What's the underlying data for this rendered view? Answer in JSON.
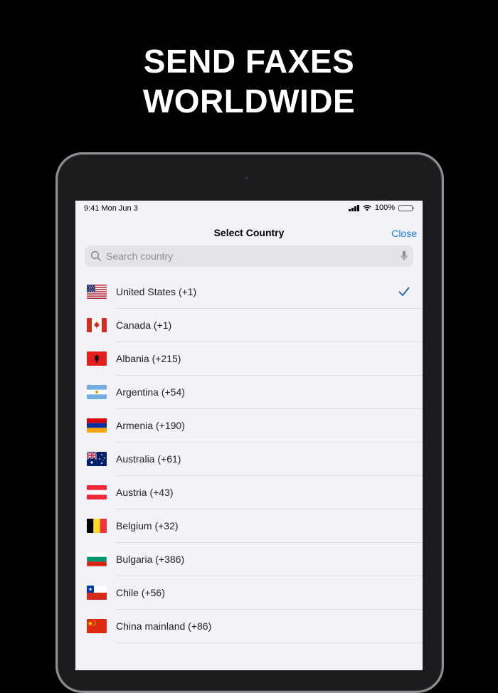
{
  "headline": {
    "line1": "SEND FAXES",
    "line2": "WORLDWIDE"
  },
  "status_bar": {
    "time": "9:41  Mon Jun 3",
    "battery": "100%"
  },
  "nav": {
    "title": "Select Country",
    "close_label": "Close"
  },
  "search": {
    "placeholder": "Search country",
    "value": ""
  },
  "colors": {
    "accent": "#1a7cf5",
    "background": "#000000",
    "sheet": "#f2f2f7"
  },
  "countries": [
    {
      "label": "United States (+1)",
      "flag": "flag-us",
      "selected": true
    },
    {
      "label": "Canada (+1)",
      "flag": "flag-ca",
      "selected": false
    },
    {
      "label": "Albania (+215)",
      "flag": "flag-al",
      "selected": false
    },
    {
      "label": "Argentina (+54)",
      "flag": "flag-ar",
      "selected": false
    },
    {
      "label": "Armenia (+190)",
      "flag": "flag-am",
      "selected": false
    },
    {
      "label": "Australia (+61)",
      "flag": "flag-au",
      "selected": false
    },
    {
      "label": "Austria (+43)",
      "flag": "flag-at",
      "selected": false
    },
    {
      "label": "Belgium (+32)",
      "flag": "flag-be",
      "selected": false
    },
    {
      "label": "Bulgaria (+386)",
      "flag": "flag-bg",
      "selected": false
    },
    {
      "label": "Chile (+56)",
      "flag": "flag-cl",
      "selected": false
    },
    {
      "label": "China mainland (+86)",
      "flag": "flag-cn",
      "selected": false
    }
  ]
}
